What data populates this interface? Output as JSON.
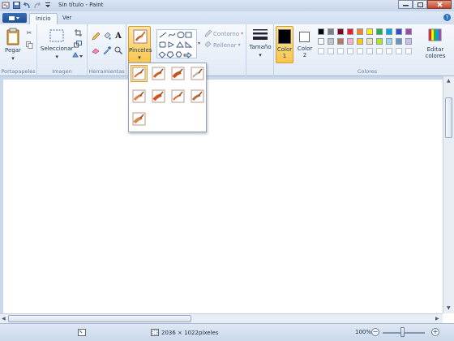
{
  "window": {
    "title": "Sin título - Paint",
    "controls": [
      "minimize",
      "maximize",
      "close"
    ]
  },
  "quick_access": [
    "save-icon",
    "undo-icon",
    "redo-icon",
    "customize-dropdown-icon"
  ],
  "tabs": [
    {
      "label": "Inicio",
      "active": true
    },
    {
      "label": "Ver",
      "active": false
    }
  ],
  "ribbon": {
    "portapapeles": {
      "label": "Portapapeles",
      "paste_label": "Pegar"
    },
    "imagen": {
      "label": "Imagen",
      "select_label": "Seleccionar"
    },
    "herramientas": {
      "label": "Herramientas",
      "text_tool_glyph": "A"
    },
    "pinceles": {
      "label": "Pinceles"
    },
    "formas": {
      "outline_label": "Contorno",
      "fill_label": "Rellenar"
    },
    "tamano": {
      "label": "Tamaño"
    },
    "color1": {
      "label": "Color",
      "number": "1",
      "color": "#000000"
    },
    "color2": {
      "label": "Color",
      "number": "2",
      "color": "#ffffff"
    },
    "colores": {
      "label": "Colores",
      "edit_label": "Editar colores"
    },
    "palette_row1": [
      "#000000",
      "#7f7f7f",
      "#880015",
      "#ed1c24",
      "#ff7f27",
      "#fff200",
      "#22b14c",
      "#00a2e8",
      "#3f48cc",
      "#a349a4"
    ],
    "palette_row2": [
      "#ffffff",
      "#c3c3c3",
      "#b97a57",
      "#ffaec9",
      "#ffc90e",
      "#efe4b0",
      "#b5e61d",
      "#99d9ea",
      "#7092be",
      "#c8bfe7"
    ]
  },
  "brush_panel": {
    "brushes": [
      {
        "name": "brush",
        "selected": true
      },
      {
        "name": "calligraphy-brush-1",
        "selected": false
      },
      {
        "name": "calligraphy-brush-2",
        "selected": false
      },
      {
        "name": "airbrush",
        "selected": false
      },
      {
        "name": "oil-brush",
        "selected": false
      },
      {
        "name": "crayon",
        "selected": false
      },
      {
        "name": "marker",
        "selected": false
      },
      {
        "name": "natural-pencil",
        "selected": false
      },
      {
        "name": "watercolor-brush",
        "selected": false
      }
    ]
  },
  "statusbar": {
    "dimensions": "2036 × 1022píxeles",
    "zoom": "100%",
    "zoom_out": "−",
    "zoom_in": "+"
  }
}
